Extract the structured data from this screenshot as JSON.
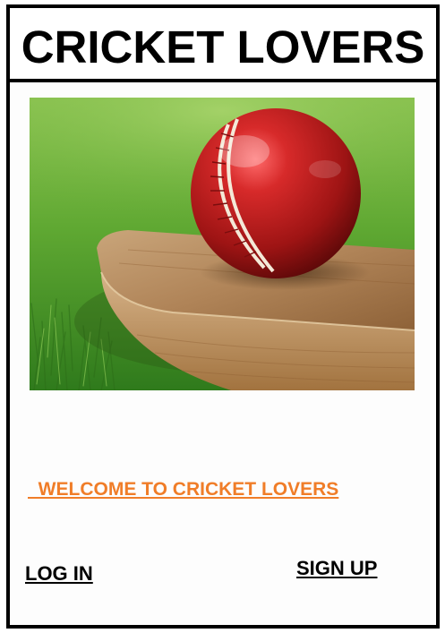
{
  "header": {
    "title": "CRICKET LOVERS"
  },
  "hero": {
    "image_subject": "cricket-ball-on-bat-image"
  },
  "main": {
    "welcome_text": "  WELCOME TO CRICKET LOVERS",
    "login_label": "LOG IN",
    "signup_label": "SIGN UP"
  },
  "colors": {
    "welcome_accent": "#f07d28",
    "border": "#000000"
  }
}
